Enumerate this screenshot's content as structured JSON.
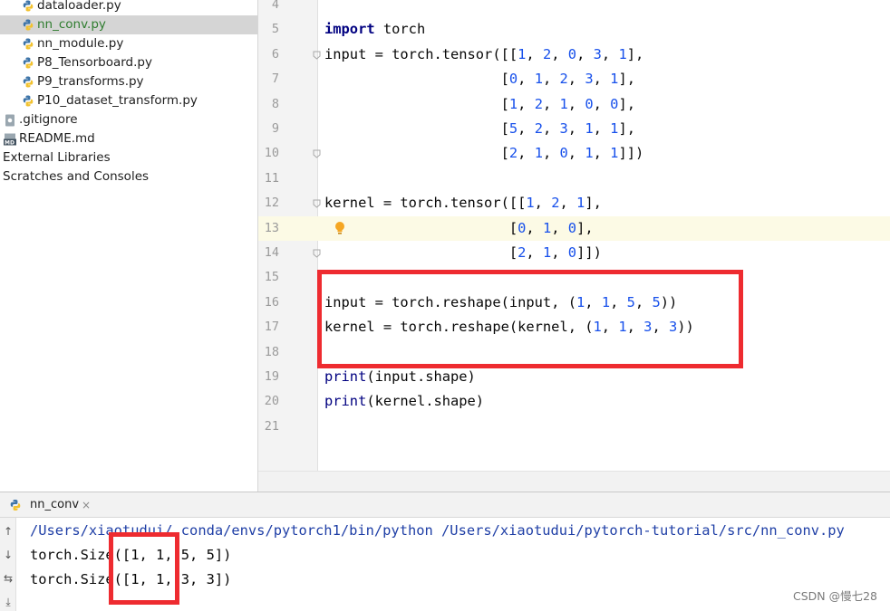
{
  "project_tree": {
    "items": [
      {
        "label": "dataloader.py",
        "kind": "python-file",
        "indent": 2,
        "selected": false
      },
      {
        "label": "nn_conv.py",
        "kind": "python-file",
        "indent": 2,
        "selected": true
      },
      {
        "label": "nn_module.py",
        "kind": "python-file",
        "indent": 2,
        "selected": false
      },
      {
        "label": "P8_Tensorboard.py",
        "kind": "python-file",
        "indent": 2,
        "selected": false
      },
      {
        "label": "P9_transforms.py",
        "kind": "python-file",
        "indent": 2,
        "selected": false
      },
      {
        "label": "P10_dataset_transform.py",
        "kind": "python-file",
        "indent": 2,
        "selected": false
      },
      {
        "label": ".gitignore",
        "kind": "gitignore-file",
        "indent": 1,
        "selected": false
      },
      {
        "label": "README.md",
        "kind": "markdown-file",
        "indent": 1,
        "selected": false
      },
      {
        "label": "External Libraries",
        "kind": "folder",
        "indent": 0,
        "selected": false
      },
      {
        "label": "Scratches and Consoles",
        "kind": "folder",
        "indent": 0,
        "selected": false
      }
    ]
  },
  "editor": {
    "current_line": 13,
    "lines": [
      {
        "n": "4",
        "code": ""
      },
      {
        "n": "5",
        "code": "import torch"
      },
      {
        "n": "6",
        "code": "input = torch.tensor([[1, 2, 0, 3, 1],"
      },
      {
        "n": "7",
        "code": "                     [0, 1, 2, 3, 1],"
      },
      {
        "n": "8",
        "code": "                     [1, 2, 1, 0, 0],"
      },
      {
        "n": "9",
        "code": "                     [5, 2, 3, 1, 1],"
      },
      {
        "n": "10",
        "code": "                     [2, 1, 0, 1, 1]])"
      },
      {
        "n": "11",
        "code": ""
      },
      {
        "n": "12",
        "code": "kernel = torch.tensor([[1, 2, 1],"
      },
      {
        "n": "13",
        "code": "                      [0, 1, 0],"
      },
      {
        "n": "14",
        "code": "                      [2, 1, 0]])"
      },
      {
        "n": "15",
        "code": ""
      },
      {
        "n": "16",
        "code": "input = torch.reshape(input, (1, 1, 5, 5))"
      },
      {
        "n": "17",
        "code": "kernel = torch.reshape(kernel, (1, 1, 3, 3))"
      },
      {
        "n": "18",
        "code": ""
      },
      {
        "n": "19",
        "code": "print(input.shape)"
      },
      {
        "n": "20",
        "code": "print(kernel.shape)"
      },
      {
        "n": "21",
        "code": ""
      }
    ]
  },
  "run_panel": {
    "tab_label": "nn_conv",
    "tab_close": "×",
    "toolbar": [
      "↑",
      "↓",
      "⇆",
      "⤓"
    ],
    "output": [
      "/Users/xiaotudui/.conda/envs/pytorch1/bin/python /Users/xiaotudui/pytorch-tutorial/src/nn_conv.py",
      "torch.Size([1, 1, 5, 5])",
      "torch.Size([1, 1, 3, 3])"
    ]
  },
  "watermark": "CSDN @慢七28",
  "colors": {
    "annotation_red": "#ee2b30",
    "keyword": "#000080",
    "number": "#1750eb",
    "current_line_bg": "#fcfae5",
    "selected_file": "#2f7d2f"
  }
}
